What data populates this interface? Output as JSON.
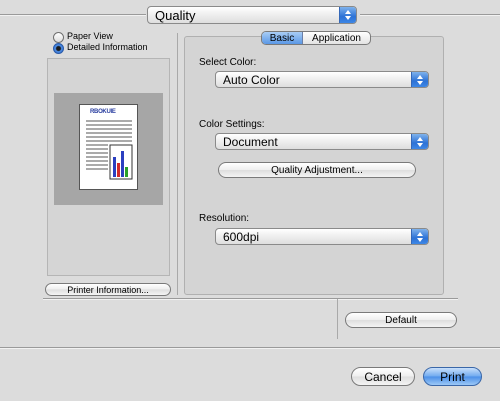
{
  "top_popup": {
    "value": "Quality"
  },
  "preview_options": [
    {
      "label": "Paper View",
      "selected": false
    },
    {
      "label": "Detailed Information",
      "selected": true
    }
  ],
  "preview": {
    "doc_heading": "RBOKUIE"
  },
  "printer_info_button": "Printer Information...",
  "tabs": [
    {
      "label": "Basic",
      "selected": true
    },
    {
      "label": "Application",
      "selected": false
    }
  ],
  "basic": {
    "select_color_label": "Select Color:",
    "select_color_value": "Auto Color",
    "color_settings_label": "Color Settings:",
    "color_settings_value": "Document",
    "quality_adjustment_button": "Quality Adjustment...",
    "resolution_label": "Resolution:",
    "resolution_value": "600dpi"
  },
  "default_button": "Default",
  "footer": {
    "cancel": "Cancel",
    "print": "Print"
  },
  "colors": {
    "accent": "#4a8fe8",
    "panel": "#d6d6d6",
    "window": "#dcdcdc"
  }
}
